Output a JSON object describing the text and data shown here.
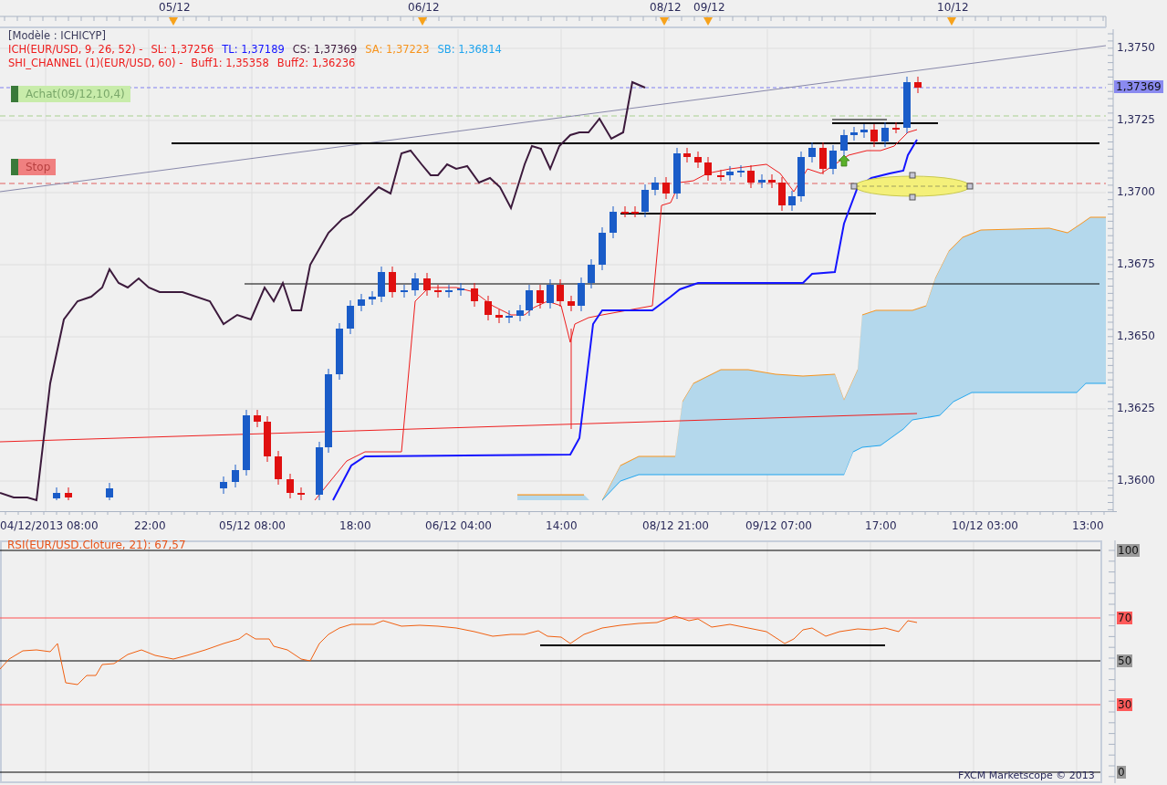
{
  "date_markers": [
    "05/12",
    "06/12",
    "08/12",
    "09/12",
    "10/12"
  ],
  "legend": {
    "template": "[Modèle : ICHICYP]",
    "ichimoku": {
      "label": "ICH(EUR/USD, 9, 26, 52) -",
      "readings": [
        {
          "text": "SL: 1,37256",
          "color": "#ee1c1c"
        },
        {
          "text": "TL: 1,37189",
          "color": "#1414ff"
        },
        {
          "text": "CS: 1,37369",
          "color": "#3c1a3c"
        },
        {
          "text": "SA: 1,37223",
          "color": "#f7941d"
        },
        {
          "text": "SB: 1,36814",
          "color": "#1ea4ee"
        }
      ]
    },
    "channel": {
      "label": "SHI_CHANNEL (1)(EUR/USD, 60) -",
      "readings": [
        "Buff1: 1,35358",
        "Buff2: 1,36236"
      ]
    }
  },
  "orders": [
    {
      "kind": "buy",
      "label": "Achat(09/12,10,4)"
    },
    {
      "kind": "stop",
      "label": "Stop"
    }
  ],
  "price_axis": {
    "current_price": "1,37369",
    "ticks": [
      "1,3750",
      "1,3725",
      "1,3700",
      "1,3675",
      "1,3650",
      "1,3625",
      "1,3600"
    ]
  },
  "time_axis": [
    "04/12/2013 08:00",
    "22:00",
    "05/12 08:00",
    "18:00",
    "06/12 04:00",
    "14:00",
    "08/12 21:00",
    "09/12 07:00",
    "17:00",
    "10/12 03:00",
    "13:00"
  ],
  "rsi": {
    "title": "RSI(EUR/USD.Cloture, 21): 67,57",
    "levels": [
      {
        "label": "100",
        "kind": "bound"
      },
      {
        "label": "70",
        "kind": "threshold"
      },
      {
        "label": "50",
        "kind": "bound"
      },
      {
        "label": "30",
        "kind": "threshold"
      },
      {
        "label": "0",
        "kind": "bound"
      }
    ]
  },
  "footer": "FXCM Marketscope © 2013"
}
